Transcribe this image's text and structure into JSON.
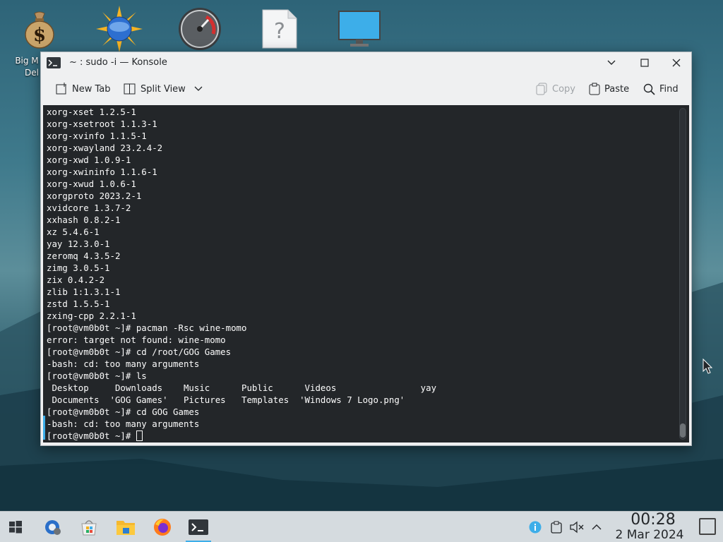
{
  "desktop": {
    "icons": [
      {
        "name": "money-bag-icon"
      },
      {
        "name": "globe-sun-icon"
      },
      {
        "name": "gauge-icon"
      },
      {
        "name": "help-icon"
      },
      {
        "name": "monitor-icon"
      }
    ],
    "first_label_line1": "Big M",
    "first_label_line2": "Del"
  },
  "window": {
    "title": "~ : sudo -i — Konsole",
    "toolbar": {
      "new_tab": "New Tab",
      "split_view": "Split View",
      "copy": "Copy",
      "paste": "Paste",
      "find": "Find"
    }
  },
  "terminal": {
    "lines": [
      "xorg-xset 1.2.5-1",
      "xorg-xsetroot 1.1.3-1",
      "xorg-xvinfo 1.1.5-1",
      "xorg-xwayland 23.2.4-2",
      "xorg-xwd 1.0.9-1",
      "xorg-xwininfo 1.1.6-1",
      "xorg-xwud 1.0.6-1",
      "xorgproto 2023.2-1",
      "xvidcore 1.3.7-2",
      "xxhash 0.8.2-1",
      "xz 5.4.6-1",
      "yay 12.3.0-1",
      "zeromq 4.3.5-2",
      "zimg 3.0.5-1",
      "zix 0.4.2-2",
      "zlib 1:1.3.1-1",
      "zstd 1.5.5-1",
      "zxing-cpp 2.2.1-1",
      "[root@vm0b0t ~]# pacman -Rsc wine-momo",
      "error: target not found: wine-momo",
      "[root@vm0b0t ~]# cd /root/GOG Games",
      "-bash: cd: too many arguments",
      "[root@vm0b0t ~]# ls",
      " Desktop     Downloads    Music      Public      Videos                yay",
      " Documents  'GOG Games'   Pictures   Templates  'Windows 7 Logo.png'",
      "[root@vm0b0t ~]# cd GOG Games",
      "-bash: cd: too many arguments"
    ],
    "prompt": "[root@vm0b0t ~]# "
  },
  "taskbar": {
    "apps": [
      {
        "name": "start-menu-icon"
      },
      {
        "name": "system-settings-icon"
      },
      {
        "name": "software-store-icon"
      },
      {
        "name": "file-manager-icon"
      },
      {
        "name": "firefox-icon"
      },
      {
        "name": "konsole-icon"
      }
    ],
    "tray": [
      {
        "name": "info-icon"
      },
      {
        "name": "clipboard-icon"
      },
      {
        "name": "volume-muted-icon"
      },
      {
        "name": "chevron-up-icon"
      }
    ],
    "time": "00:28",
    "date": "2 Mar 2024"
  },
  "colors": {
    "accent": "#3daee9",
    "terminal_bg": "#232629",
    "terminal_fg": "#fcfcfc"
  }
}
